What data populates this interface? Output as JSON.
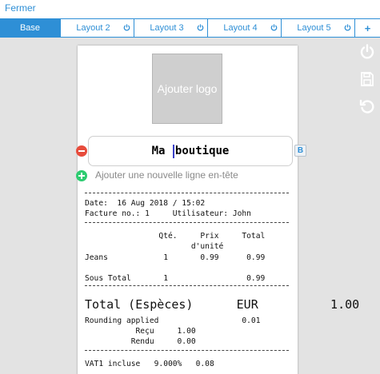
{
  "header": {
    "close_label": "Fermer"
  },
  "tabs": [
    {
      "label": "Base",
      "active": true
    },
    {
      "label": "Layout 2"
    },
    {
      "label": "Layout 3"
    },
    {
      "label": "Layout 4"
    },
    {
      "label": "Layout 5"
    }
  ],
  "tab_add_label": "+",
  "colors": {
    "accent": "#2e8fd6",
    "remove": "#e74c3c",
    "add": "#2ecc71",
    "cursor": "#3a40c8"
  },
  "side_tools": [
    "power-icon",
    "save-icon",
    "undo-icon"
  ],
  "receipt": {
    "logo_label": "Ajouter logo",
    "shop_name_before": "Ma ",
    "shop_name_after": "boutique",
    "bold_label": "B",
    "add_header_line": "Ajouter une nouvelle ligne en-tête",
    "lines": {
      "date": "Date:  16 Aug 2018 / 15:02",
      "invoice": "Facture no.: 1     Utilisateur: John",
      "col_header_1": "                Qté.     Prix     Total",
      "col_header_2": "                       d'unité",
      "item_jeans": "Jeans            1       0.99      0.99",
      "subtotal": "Sous Total       1                 0.99",
      "total": "Total (Espèces)      EUR          1.00",
      "rounding": "Rounding applied                  0.01",
      "recu": "           Reçu     1.00",
      "rendu": "          Rendu     0.00",
      "vat": "VAT1 incluse   9.000%   0.08"
    }
  }
}
